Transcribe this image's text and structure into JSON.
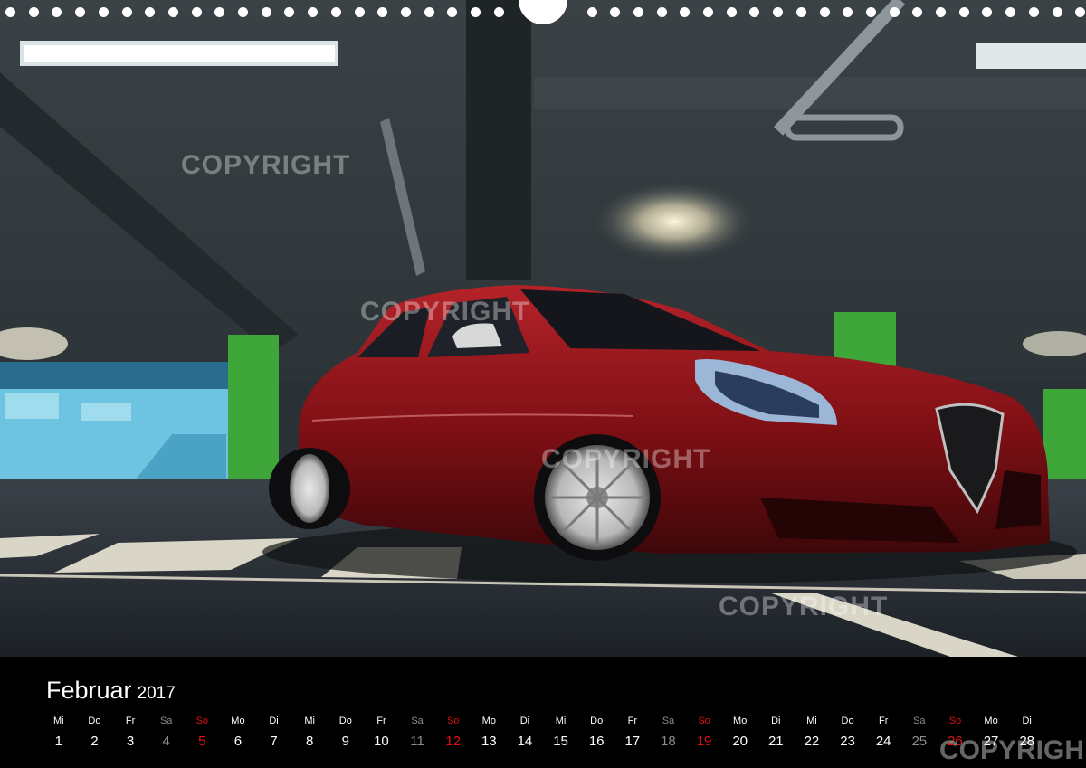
{
  "calendar": {
    "month": "Februar",
    "year": "2017",
    "days": [
      {
        "dn": "Mi",
        "d": "1",
        "t": ""
      },
      {
        "dn": "Do",
        "d": "2",
        "t": ""
      },
      {
        "dn": "Fr",
        "d": "3",
        "t": ""
      },
      {
        "dn": "Sa",
        "d": "4",
        "t": "sa"
      },
      {
        "dn": "So",
        "d": "5",
        "t": "so"
      },
      {
        "dn": "Mo",
        "d": "6",
        "t": ""
      },
      {
        "dn": "Di",
        "d": "7",
        "t": ""
      },
      {
        "dn": "Mi",
        "d": "8",
        "t": ""
      },
      {
        "dn": "Do",
        "d": "9",
        "t": ""
      },
      {
        "dn": "Fr",
        "d": "10",
        "t": ""
      },
      {
        "dn": "Sa",
        "d": "11",
        "t": "sa"
      },
      {
        "dn": "So",
        "d": "12",
        "t": "so"
      },
      {
        "dn": "Mo",
        "d": "13",
        "t": ""
      },
      {
        "dn": "Di",
        "d": "14",
        "t": ""
      },
      {
        "dn": "Mi",
        "d": "15",
        "t": ""
      },
      {
        "dn": "Do",
        "d": "16",
        "t": ""
      },
      {
        "dn": "Fr",
        "d": "17",
        "t": ""
      },
      {
        "dn": "Sa",
        "d": "18",
        "t": "sa"
      },
      {
        "dn": "So",
        "d": "19",
        "t": "so"
      },
      {
        "dn": "Mo",
        "d": "20",
        "t": ""
      },
      {
        "dn": "Di",
        "d": "21",
        "t": ""
      },
      {
        "dn": "Mi",
        "d": "22",
        "t": ""
      },
      {
        "dn": "Do",
        "d": "23",
        "t": ""
      },
      {
        "dn": "Fr",
        "d": "24",
        "t": ""
      },
      {
        "dn": "Sa",
        "d": "25",
        "t": "sa"
      },
      {
        "dn": "So",
        "d": "26",
        "t": "so"
      },
      {
        "dn": "Mo",
        "d": "27",
        "t": ""
      },
      {
        "dn": "Di",
        "d": "28",
        "t": ""
      }
    ]
  },
  "watermark": "COPYRIGHT",
  "watermark_bottom": "COPYRIGH",
  "colors": {
    "weekend_saturday": "#8c8c8c",
    "weekend_sunday": "#e01010",
    "car": "#8e1418",
    "pillar": "#3fa63a"
  }
}
